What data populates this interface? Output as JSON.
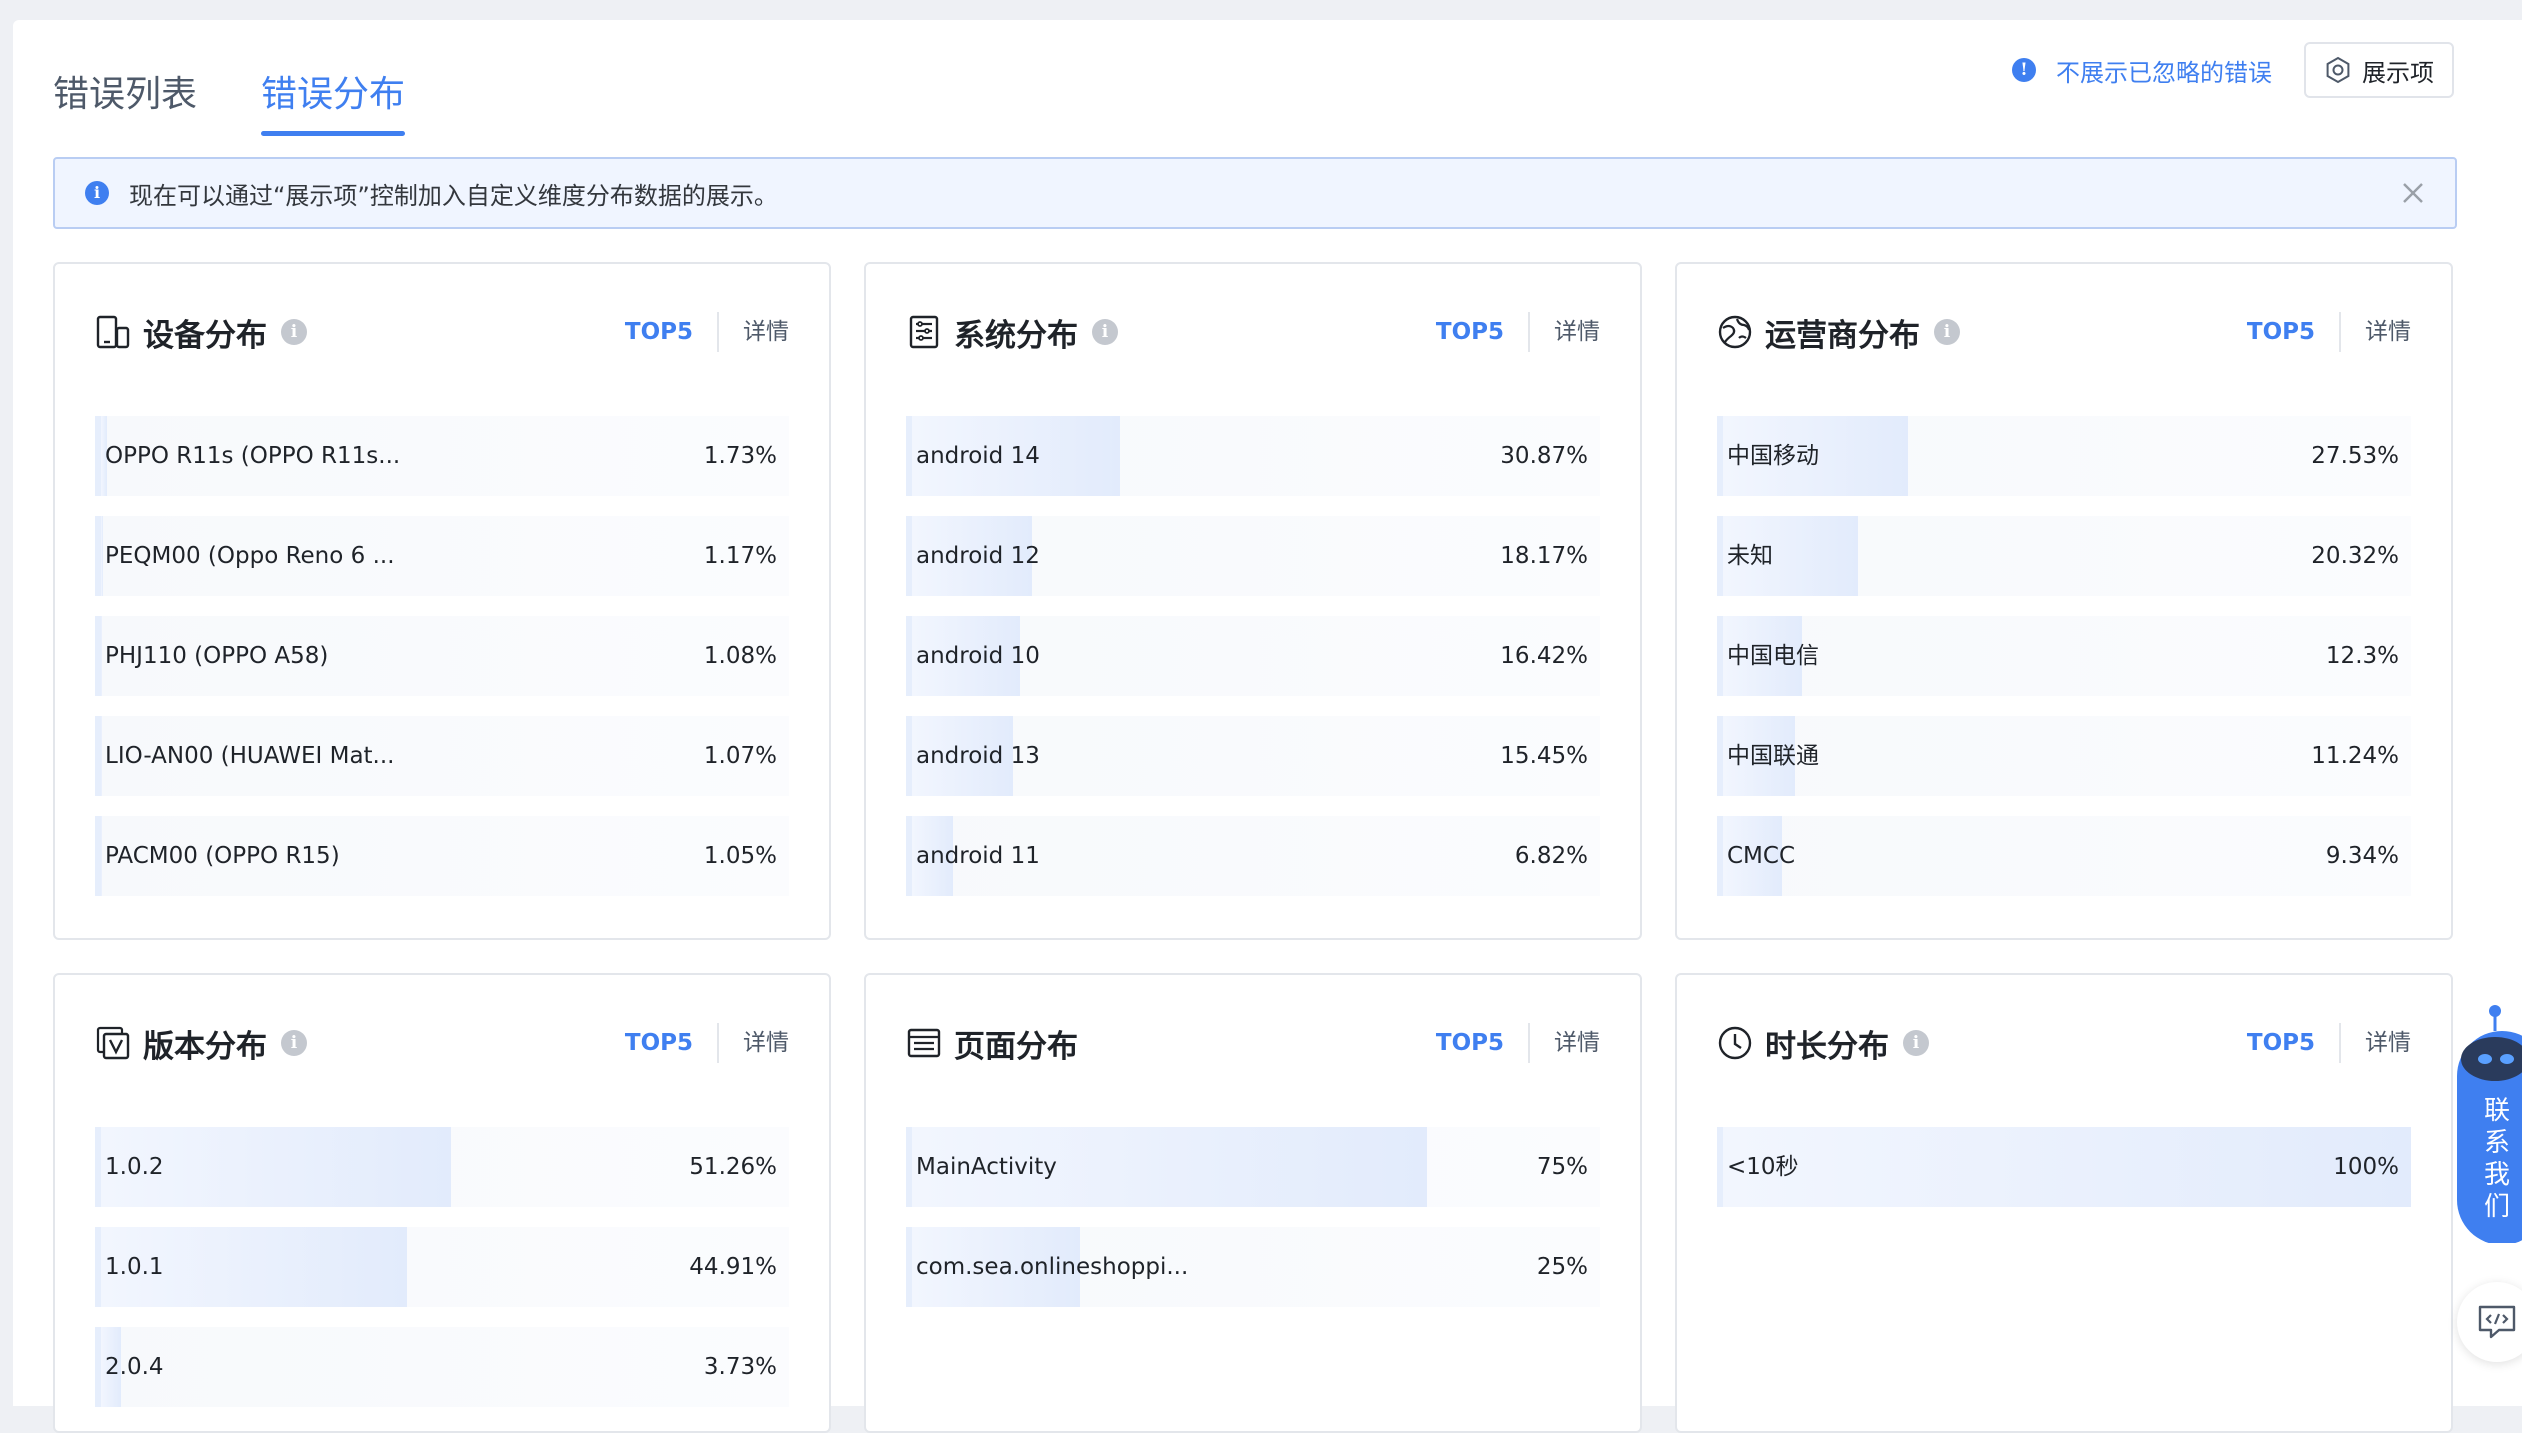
{
  "tabs": [
    {
      "label": "错误列表",
      "active": false
    },
    {
      "label": "错误分布",
      "active": true
    }
  ],
  "header": {
    "ignored_label": "不展示已忽略的错误",
    "display_label": "展示项"
  },
  "notice": {
    "text": "现在可以通过“展示项”控制加入自定义维度分布数据的展示。"
  },
  "cards": [
    {
      "title": "设备分布",
      "icon": "device-icon",
      "help": true,
      "top5": "TOP5",
      "detail": "详情",
      "rows": [
        {
          "label": "OPPO R11s (OPPO R11s...",
          "value": "1.73%",
          "pct": 1.73
        },
        {
          "label": "PEQM00 (Oppo Reno 6 ...",
          "value": "1.17%",
          "pct": 1.17
        },
        {
          "label": "PHJ110 (OPPO A58)",
          "value": "1.08%",
          "pct": 1.08
        },
        {
          "label": "LIO-AN00 (HUAWEI Mat...",
          "value": "1.07%",
          "pct": 1.07
        },
        {
          "label": "PACM00 (OPPO R15)",
          "value": "1.05%",
          "pct": 1.05
        }
      ]
    },
    {
      "title": "系统分布",
      "icon": "system-icon",
      "help": true,
      "top5": "TOP5",
      "detail": "详情",
      "rows": [
        {
          "label": "android 14",
          "value": "30.87%",
          "pct": 30.87
        },
        {
          "label": "android 12",
          "value": "18.17%",
          "pct": 18.17
        },
        {
          "label": "android 10",
          "value": "16.42%",
          "pct": 16.42
        },
        {
          "label": "android 13",
          "value": "15.45%",
          "pct": 15.45
        },
        {
          "label": "android 11",
          "value": "6.82%",
          "pct": 6.82
        }
      ]
    },
    {
      "title": "运营商分布",
      "icon": "globe-icon",
      "help": true,
      "top5": "TOP5",
      "detail": "详情",
      "rows": [
        {
          "label": "中国移动",
          "value": "27.53%",
          "pct": 27.53
        },
        {
          "label": "未知",
          "value": "20.32%",
          "pct": 20.32
        },
        {
          "label": "中国电信",
          "value": "12.3%",
          "pct": 12.3
        },
        {
          "label": "中国联通",
          "value": "11.24%",
          "pct": 11.24
        },
        {
          "label": "CMCC",
          "value": "9.34%",
          "pct": 9.34
        }
      ]
    },
    {
      "title": "版本分布",
      "icon": "version-icon",
      "help": true,
      "top5": "TOP5",
      "detail": "详情",
      "rows": [
        {
          "label": "1.0.2",
          "value": "51.26%",
          "pct": 51.26
        },
        {
          "label": "1.0.1",
          "value": "44.91%",
          "pct": 44.91
        },
        {
          "label": "2.0.4",
          "value": "3.73%",
          "pct": 3.73
        }
      ]
    },
    {
      "title": "页面分布",
      "icon": "page-icon",
      "help": false,
      "top5": "TOP5",
      "detail": "详情",
      "rows": [
        {
          "label": "MainActivity",
          "value": "75%",
          "pct": 75
        },
        {
          "label": "com.sea.onlineshoppi...",
          "value": "25%",
          "pct": 25
        }
      ]
    },
    {
      "title": "时长分布",
      "icon": "clock-icon",
      "help": true,
      "top5": "TOP5",
      "detail": "详情",
      "rows": [
        {
          "label": "<10秒",
          "value": "100%",
          "pct": 100
        }
      ]
    }
  ],
  "contact": {
    "chars": [
      "联",
      "系",
      "我",
      "们"
    ]
  },
  "colors": {
    "accent": "#3f7ff0",
    "bar_start": "#f2f6fe",
    "bar_end": "#e2ebfc"
  }
}
